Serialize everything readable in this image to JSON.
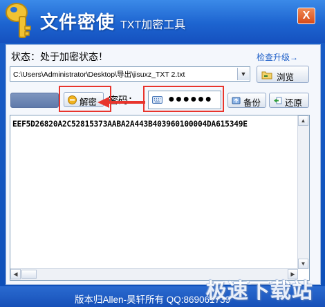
{
  "window": {
    "title": "文件密使",
    "subtitle": "TXT加密工具",
    "close_label": "X",
    "accent": "#1d64d0"
  },
  "status": {
    "text": "状态：处于加密状态！",
    "upgrade_link": "检查升级→"
  },
  "file": {
    "path": "C:\\Users\\Administrator\\Desktop\\导出\\jisuxz_TXT 2.txt",
    "browse_label": "浏览"
  },
  "actions": {
    "decrypt_label": "解密",
    "password_label": "密码：",
    "password_value": "●●●●●●",
    "backup_label": "备份",
    "restore_label": "还原"
  },
  "content": {
    "ciphertext": "EEF5D26820A2C52815373AABA2A443B403960100004DA615349E"
  },
  "footer": {
    "copyright": "版本归Allen-昊轩所有  QQ:869061739",
    "watermark": "极速下载站"
  },
  "icons": {
    "app": "key-icon",
    "browse": "folder-icon",
    "decrypt": "unlock-icon",
    "password": "keyboard-icon",
    "backup": "backup-icon",
    "restore": "restore-icon"
  },
  "annotation_color": "#e8342c"
}
